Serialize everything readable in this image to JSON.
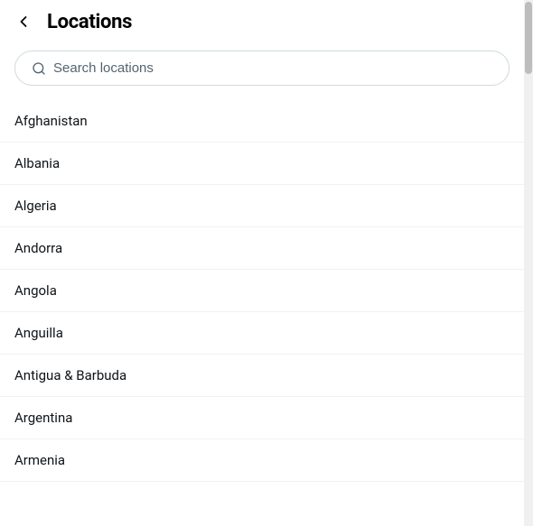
{
  "header": {
    "title": "Locations",
    "back_label": "←"
  },
  "search": {
    "placeholder": "Search locations",
    "value": ""
  },
  "locations": [
    "Afghanistan",
    "Albania",
    "Algeria",
    "Andorra",
    "Angola",
    "Anguilla",
    "Antigua & Barbuda",
    "Argentina",
    "Armenia"
  ]
}
